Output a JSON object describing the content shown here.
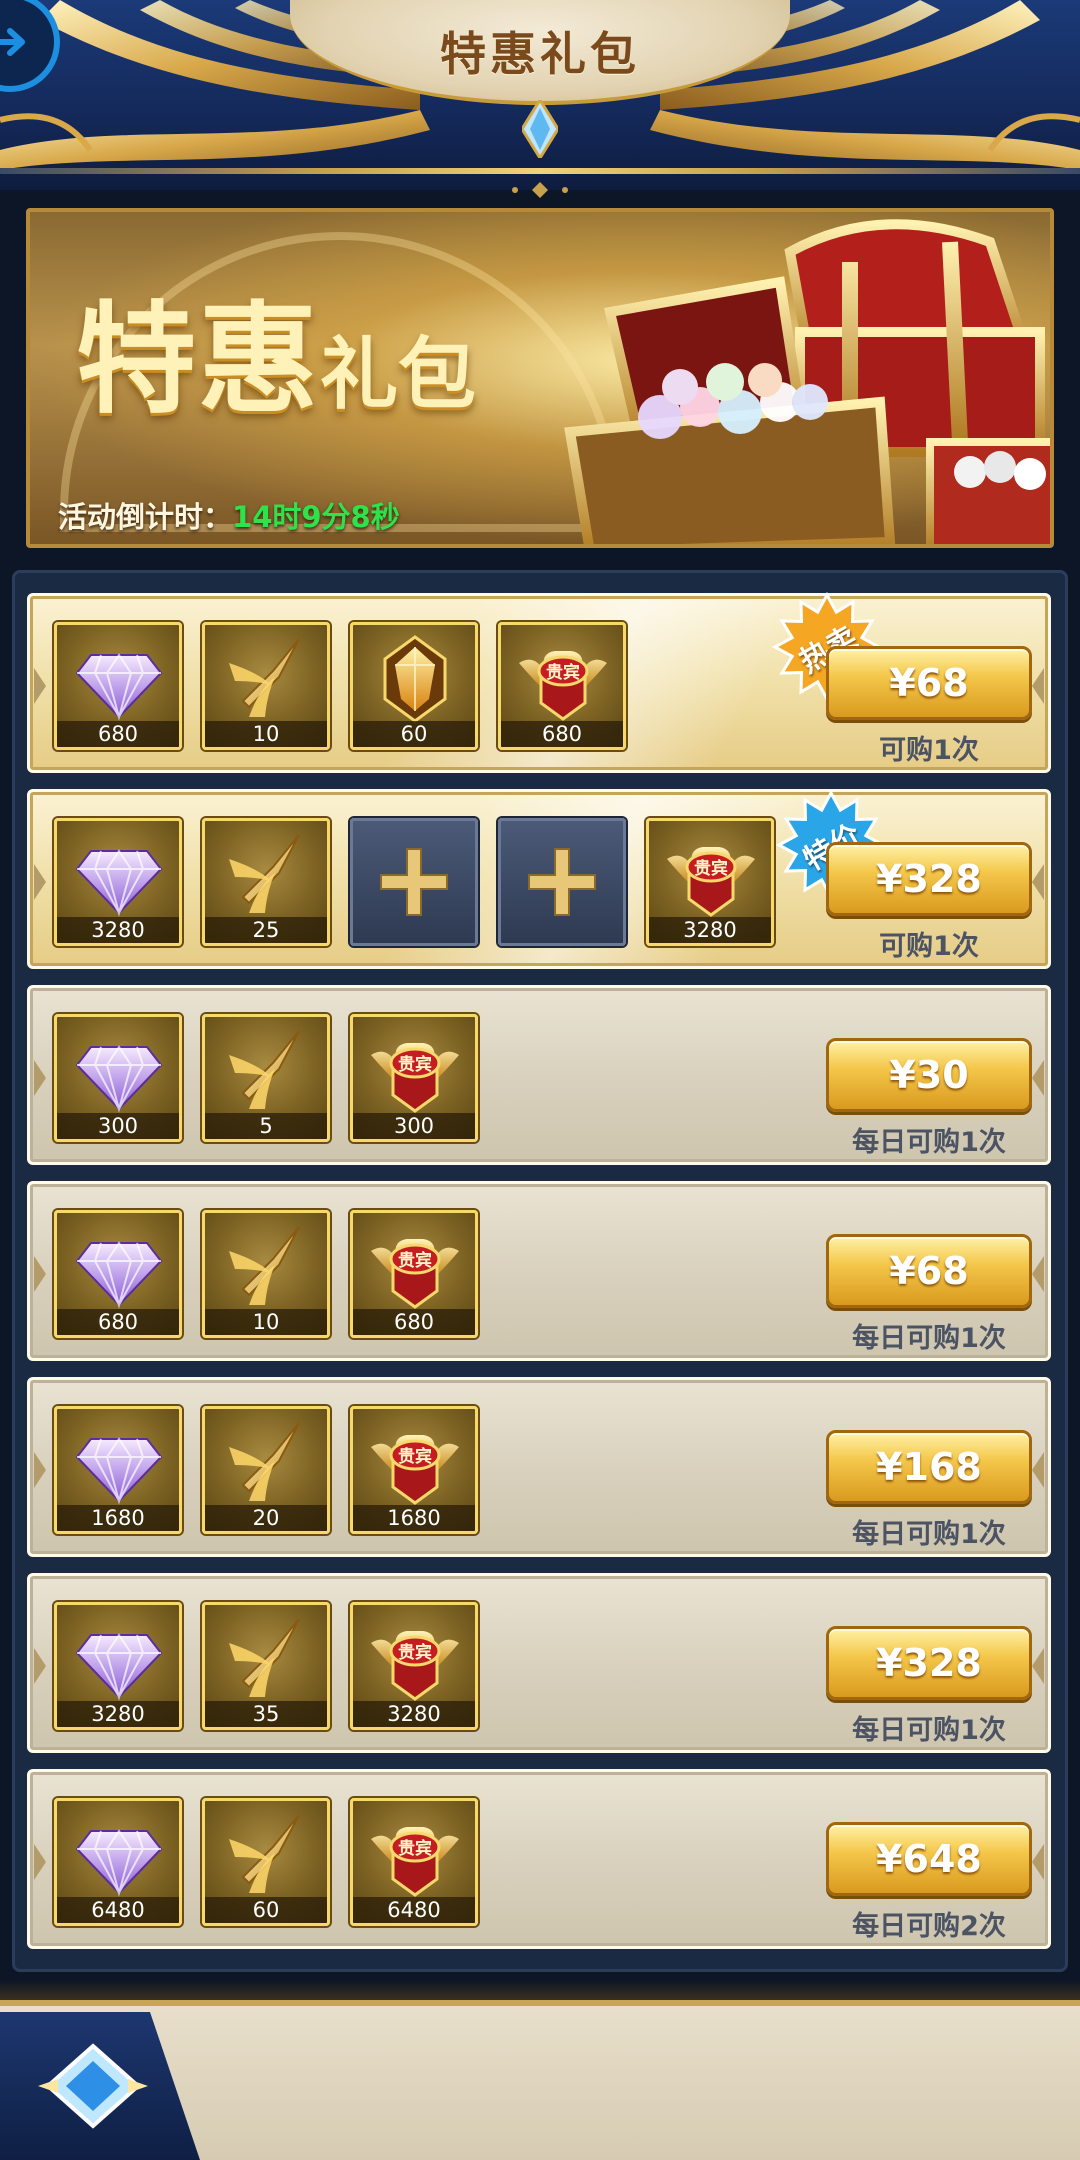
{
  "header": {
    "title": "特惠礼包",
    "back_icon": "arrow-right-circle-icon",
    "accent": "#1d8fe0"
  },
  "banner": {
    "title_big": "特惠",
    "title_small": "礼包",
    "countdown_label": "活动倒计时：",
    "countdown_value": "14时9分8秒",
    "countdown_color": "#2ee34a"
  },
  "packs": [
    {
      "style": "gold",
      "badge": "热卖",
      "badge_color": "#f5a623",
      "items": [
        {
          "icon": "diamond-icon",
          "qty": "680"
        },
        {
          "icon": "spear-icon",
          "qty": "10"
        },
        {
          "icon": "amber-crystal-icon",
          "qty": "60"
        },
        {
          "icon": "vip-emblem-icon",
          "qty": "680"
        }
      ],
      "price": "¥68",
      "limit": "可购1次"
    },
    {
      "style": "gold",
      "badge": "特价",
      "badge_color": "#2aa6e8",
      "items": [
        {
          "icon": "diamond-icon",
          "qty": "3280"
        },
        {
          "icon": "spear-icon",
          "qty": "25"
        },
        {
          "icon": "plus-slot-icon",
          "qty": ""
        },
        {
          "icon": "plus-slot-icon",
          "qty": ""
        },
        {
          "icon": "vip-emblem-icon",
          "qty": "3280"
        }
      ],
      "price": "¥328",
      "limit": "可购1次"
    },
    {
      "style": "plain",
      "badge": "",
      "items": [
        {
          "icon": "diamond-icon",
          "qty": "300"
        },
        {
          "icon": "spear-icon",
          "qty": "5"
        },
        {
          "icon": "vip-emblem-icon",
          "qty": "300"
        }
      ],
      "price": "¥30",
      "limit": "每日可购1次"
    },
    {
      "style": "plain",
      "badge": "",
      "items": [
        {
          "icon": "diamond-icon",
          "qty": "680"
        },
        {
          "icon": "spear-icon",
          "qty": "10"
        },
        {
          "icon": "vip-emblem-icon",
          "qty": "680"
        }
      ],
      "price": "¥68",
      "limit": "每日可购1次"
    },
    {
      "style": "plain",
      "badge": "",
      "items": [
        {
          "icon": "diamond-icon",
          "qty": "1680"
        },
        {
          "icon": "spear-icon",
          "qty": "20"
        },
        {
          "icon": "vip-emblem-icon",
          "qty": "1680"
        }
      ],
      "price": "¥168",
      "limit": "每日可购1次"
    },
    {
      "style": "plain",
      "badge": "",
      "items": [
        {
          "icon": "diamond-icon",
          "qty": "3280"
        },
        {
          "icon": "spear-icon",
          "qty": "35"
        },
        {
          "icon": "vip-emblem-icon",
          "qty": "3280"
        }
      ],
      "price": "¥328",
      "limit": "每日可购1次"
    },
    {
      "style": "plain",
      "badge": "",
      "items": [
        {
          "icon": "diamond-icon",
          "qty": "6480"
        },
        {
          "icon": "spear-icon",
          "qty": "60"
        },
        {
          "icon": "vip-emblem-icon",
          "qty": "6480"
        }
      ],
      "price": "¥648",
      "limit": "每日可购2次"
    }
  ],
  "vip_emblem_text": "贵宾",
  "bottom": {
    "tab_icon": "crystal-emblem-icon"
  }
}
